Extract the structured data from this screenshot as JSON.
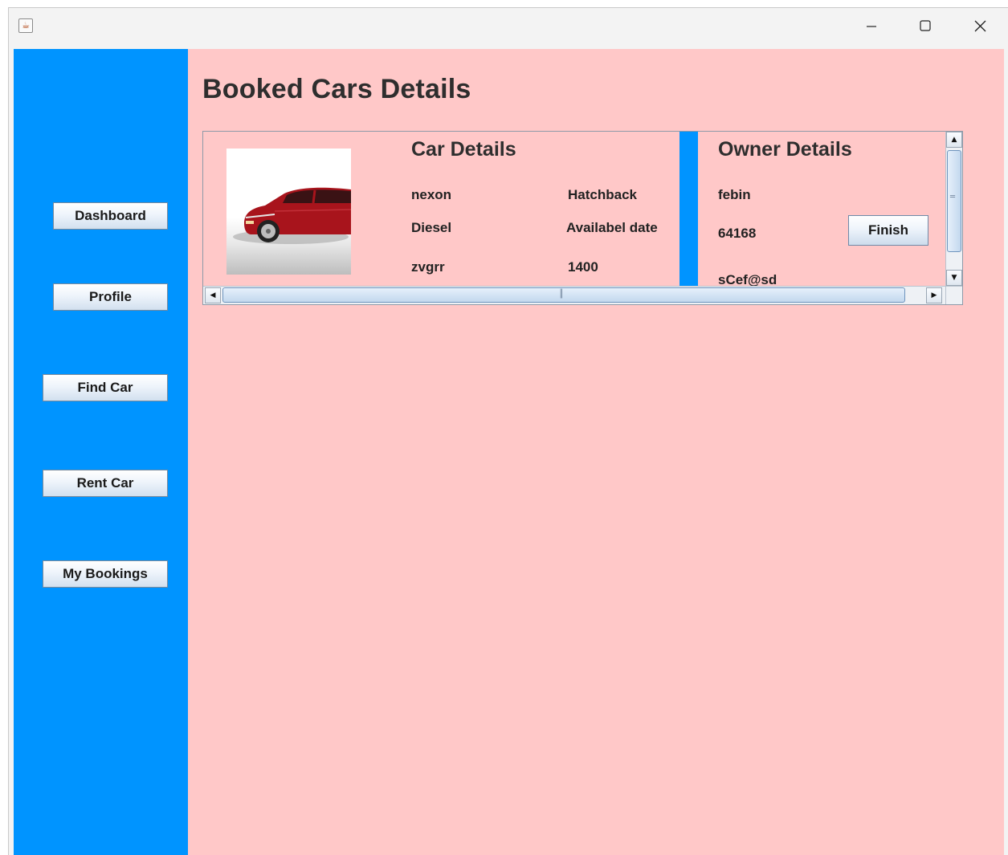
{
  "window": {
    "app_icon": "java-coffee-cup-icon",
    "controls": {
      "minimize_icon": "minimize-icon",
      "maximize_icon": "maximize-icon",
      "close_icon": "close-icon"
    }
  },
  "sidebar": {
    "buttons": [
      {
        "label": "Dashboard"
      },
      {
        "label": "Profile"
      },
      {
        "label": "Find Car"
      },
      {
        "label": "Rent Car"
      },
      {
        "label": "My Bookings"
      }
    ]
  },
  "main": {
    "title": "Booked Cars Details",
    "booking": {
      "image": "red-sedan-car-image",
      "car_details": {
        "title": "Car Details",
        "name": "nexon",
        "type": "Hatchback",
        "fuel": "Diesel",
        "available_label": "Availabel date",
        "extra": "zvgrr",
        "price": "1400"
      },
      "owner_details": {
        "title": "Owner Details",
        "name": "febin",
        "phone": "64168",
        "email": "sCef@sd",
        "finish_label": "Finish"
      }
    }
  },
  "colors": {
    "sidebar_bg": "#0094ff",
    "content_bg": "#ffc8c8",
    "title_text": "#2e2e2e",
    "titlebar_bg": "#f3f3f3"
  }
}
